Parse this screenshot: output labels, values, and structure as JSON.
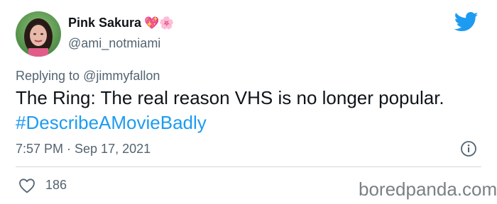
{
  "user": {
    "display_name": "Pink Sakura",
    "name_emojis": "💖🌸",
    "handle": "@ami_notmiami"
  },
  "reply": {
    "prefix": "Replying to ",
    "mention": "@jimmyfallon"
  },
  "tweet": {
    "text": "The Ring: The real reason VHS is no longer popular. ",
    "hashtag": "#DescribeAMovieBadly"
  },
  "meta": {
    "timestamp": "7:57 PM · Sep 17, 2021"
  },
  "actions": {
    "like_count": "186"
  },
  "watermark": "boredpanda.com",
  "icons": [
    "avatar",
    "twitter-bird-icon",
    "info-icon",
    "heart-icon"
  ],
  "colors": {
    "link": "#1d9bf0",
    "secondary_text": "#536471",
    "twitter_blue": "#1d9bf0"
  }
}
